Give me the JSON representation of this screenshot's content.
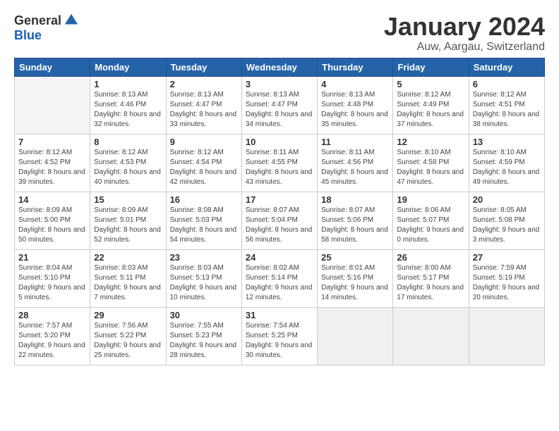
{
  "logo": {
    "general": "General",
    "blue": "Blue"
  },
  "header": {
    "title": "January 2024",
    "subtitle": "Auw, Aargau, Switzerland"
  },
  "weekdays": [
    "Sunday",
    "Monday",
    "Tuesday",
    "Wednesday",
    "Thursday",
    "Friday",
    "Saturday"
  ],
  "weeks": [
    [
      {
        "day": null,
        "empty": true
      },
      {
        "day": "1",
        "sunrise": "Sunrise: 8:13 AM",
        "sunset": "Sunset: 4:46 PM",
        "daylight": "Daylight: 8 hours and 32 minutes."
      },
      {
        "day": "2",
        "sunrise": "Sunrise: 8:13 AM",
        "sunset": "Sunset: 4:47 PM",
        "daylight": "Daylight: 8 hours and 33 minutes."
      },
      {
        "day": "3",
        "sunrise": "Sunrise: 8:13 AM",
        "sunset": "Sunset: 4:47 PM",
        "daylight": "Daylight: 8 hours and 34 minutes."
      },
      {
        "day": "4",
        "sunrise": "Sunrise: 8:13 AM",
        "sunset": "Sunset: 4:48 PM",
        "daylight": "Daylight: 8 hours and 35 minutes."
      },
      {
        "day": "5",
        "sunrise": "Sunrise: 8:12 AM",
        "sunset": "Sunset: 4:49 PM",
        "daylight": "Daylight: 8 hours and 37 minutes."
      },
      {
        "day": "6",
        "sunrise": "Sunrise: 8:12 AM",
        "sunset": "Sunset: 4:51 PM",
        "daylight": "Daylight: 8 hours and 38 minutes."
      }
    ],
    [
      {
        "day": "7",
        "sunrise": "Sunrise: 8:12 AM",
        "sunset": "Sunset: 4:52 PM",
        "daylight": "Daylight: 8 hours and 39 minutes."
      },
      {
        "day": "8",
        "sunrise": "Sunrise: 8:12 AM",
        "sunset": "Sunset: 4:53 PM",
        "daylight": "Daylight: 8 hours and 40 minutes."
      },
      {
        "day": "9",
        "sunrise": "Sunrise: 8:12 AM",
        "sunset": "Sunset: 4:54 PM",
        "daylight": "Daylight: 8 hours and 42 minutes."
      },
      {
        "day": "10",
        "sunrise": "Sunrise: 8:11 AM",
        "sunset": "Sunset: 4:55 PM",
        "daylight": "Daylight: 8 hours and 43 minutes."
      },
      {
        "day": "11",
        "sunrise": "Sunrise: 8:11 AM",
        "sunset": "Sunset: 4:56 PM",
        "daylight": "Daylight: 8 hours and 45 minutes."
      },
      {
        "day": "12",
        "sunrise": "Sunrise: 8:10 AM",
        "sunset": "Sunset: 4:58 PM",
        "daylight": "Daylight: 8 hours and 47 minutes."
      },
      {
        "day": "13",
        "sunrise": "Sunrise: 8:10 AM",
        "sunset": "Sunset: 4:59 PM",
        "daylight": "Daylight: 8 hours and 49 minutes."
      }
    ],
    [
      {
        "day": "14",
        "sunrise": "Sunrise: 8:09 AM",
        "sunset": "Sunset: 5:00 PM",
        "daylight": "Daylight: 8 hours and 50 minutes."
      },
      {
        "day": "15",
        "sunrise": "Sunrise: 8:09 AM",
        "sunset": "Sunset: 5:01 PM",
        "daylight": "Daylight: 8 hours and 52 minutes."
      },
      {
        "day": "16",
        "sunrise": "Sunrise: 8:08 AM",
        "sunset": "Sunset: 5:03 PM",
        "daylight": "Daylight: 8 hours and 54 minutes."
      },
      {
        "day": "17",
        "sunrise": "Sunrise: 8:07 AM",
        "sunset": "Sunset: 5:04 PM",
        "daylight": "Daylight: 8 hours and 56 minutes."
      },
      {
        "day": "18",
        "sunrise": "Sunrise: 8:07 AM",
        "sunset": "Sunset: 5:06 PM",
        "daylight": "Daylight: 8 hours and 58 minutes."
      },
      {
        "day": "19",
        "sunrise": "Sunrise: 8:06 AM",
        "sunset": "Sunset: 5:07 PM",
        "daylight": "Daylight: 9 hours and 0 minutes."
      },
      {
        "day": "20",
        "sunrise": "Sunrise: 8:05 AM",
        "sunset": "Sunset: 5:08 PM",
        "daylight": "Daylight: 9 hours and 3 minutes."
      }
    ],
    [
      {
        "day": "21",
        "sunrise": "Sunrise: 8:04 AM",
        "sunset": "Sunset: 5:10 PM",
        "daylight": "Daylight: 9 hours and 5 minutes."
      },
      {
        "day": "22",
        "sunrise": "Sunrise: 8:03 AM",
        "sunset": "Sunset: 5:11 PM",
        "daylight": "Daylight: 9 hours and 7 minutes."
      },
      {
        "day": "23",
        "sunrise": "Sunrise: 8:03 AM",
        "sunset": "Sunset: 5:13 PM",
        "daylight": "Daylight: 9 hours and 10 minutes."
      },
      {
        "day": "24",
        "sunrise": "Sunrise: 8:02 AM",
        "sunset": "Sunset: 5:14 PM",
        "daylight": "Daylight: 9 hours and 12 minutes."
      },
      {
        "day": "25",
        "sunrise": "Sunrise: 8:01 AM",
        "sunset": "Sunset: 5:16 PM",
        "daylight": "Daylight: 9 hours and 14 minutes."
      },
      {
        "day": "26",
        "sunrise": "Sunrise: 8:00 AM",
        "sunset": "Sunset: 5:17 PM",
        "daylight": "Daylight: 9 hours and 17 minutes."
      },
      {
        "day": "27",
        "sunrise": "Sunrise: 7:59 AM",
        "sunset": "Sunset: 5:19 PM",
        "daylight": "Daylight: 9 hours and 20 minutes."
      }
    ],
    [
      {
        "day": "28",
        "sunrise": "Sunrise: 7:57 AM",
        "sunset": "Sunset: 5:20 PM",
        "daylight": "Daylight: 9 hours and 22 minutes."
      },
      {
        "day": "29",
        "sunrise": "Sunrise: 7:56 AM",
        "sunset": "Sunset: 5:22 PM",
        "daylight": "Daylight: 9 hours and 25 minutes."
      },
      {
        "day": "30",
        "sunrise": "Sunrise: 7:55 AM",
        "sunset": "Sunset: 5:23 PM",
        "daylight": "Daylight: 9 hours and 28 minutes."
      },
      {
        "day": "31",
        "sunrise": "Sunrise: 7:54 AM",
        "sunset": "Sunset: 5:25 PM",
        "daylight": "Daylight: 9 hours and 30 minutes."
      },
      {
        "day": null,
        "empty": true
      },
      {
        "day": null,
        "empty": true
      },
      {
        "day": null,
        "empty": true
      }
    ]
  ]
}
